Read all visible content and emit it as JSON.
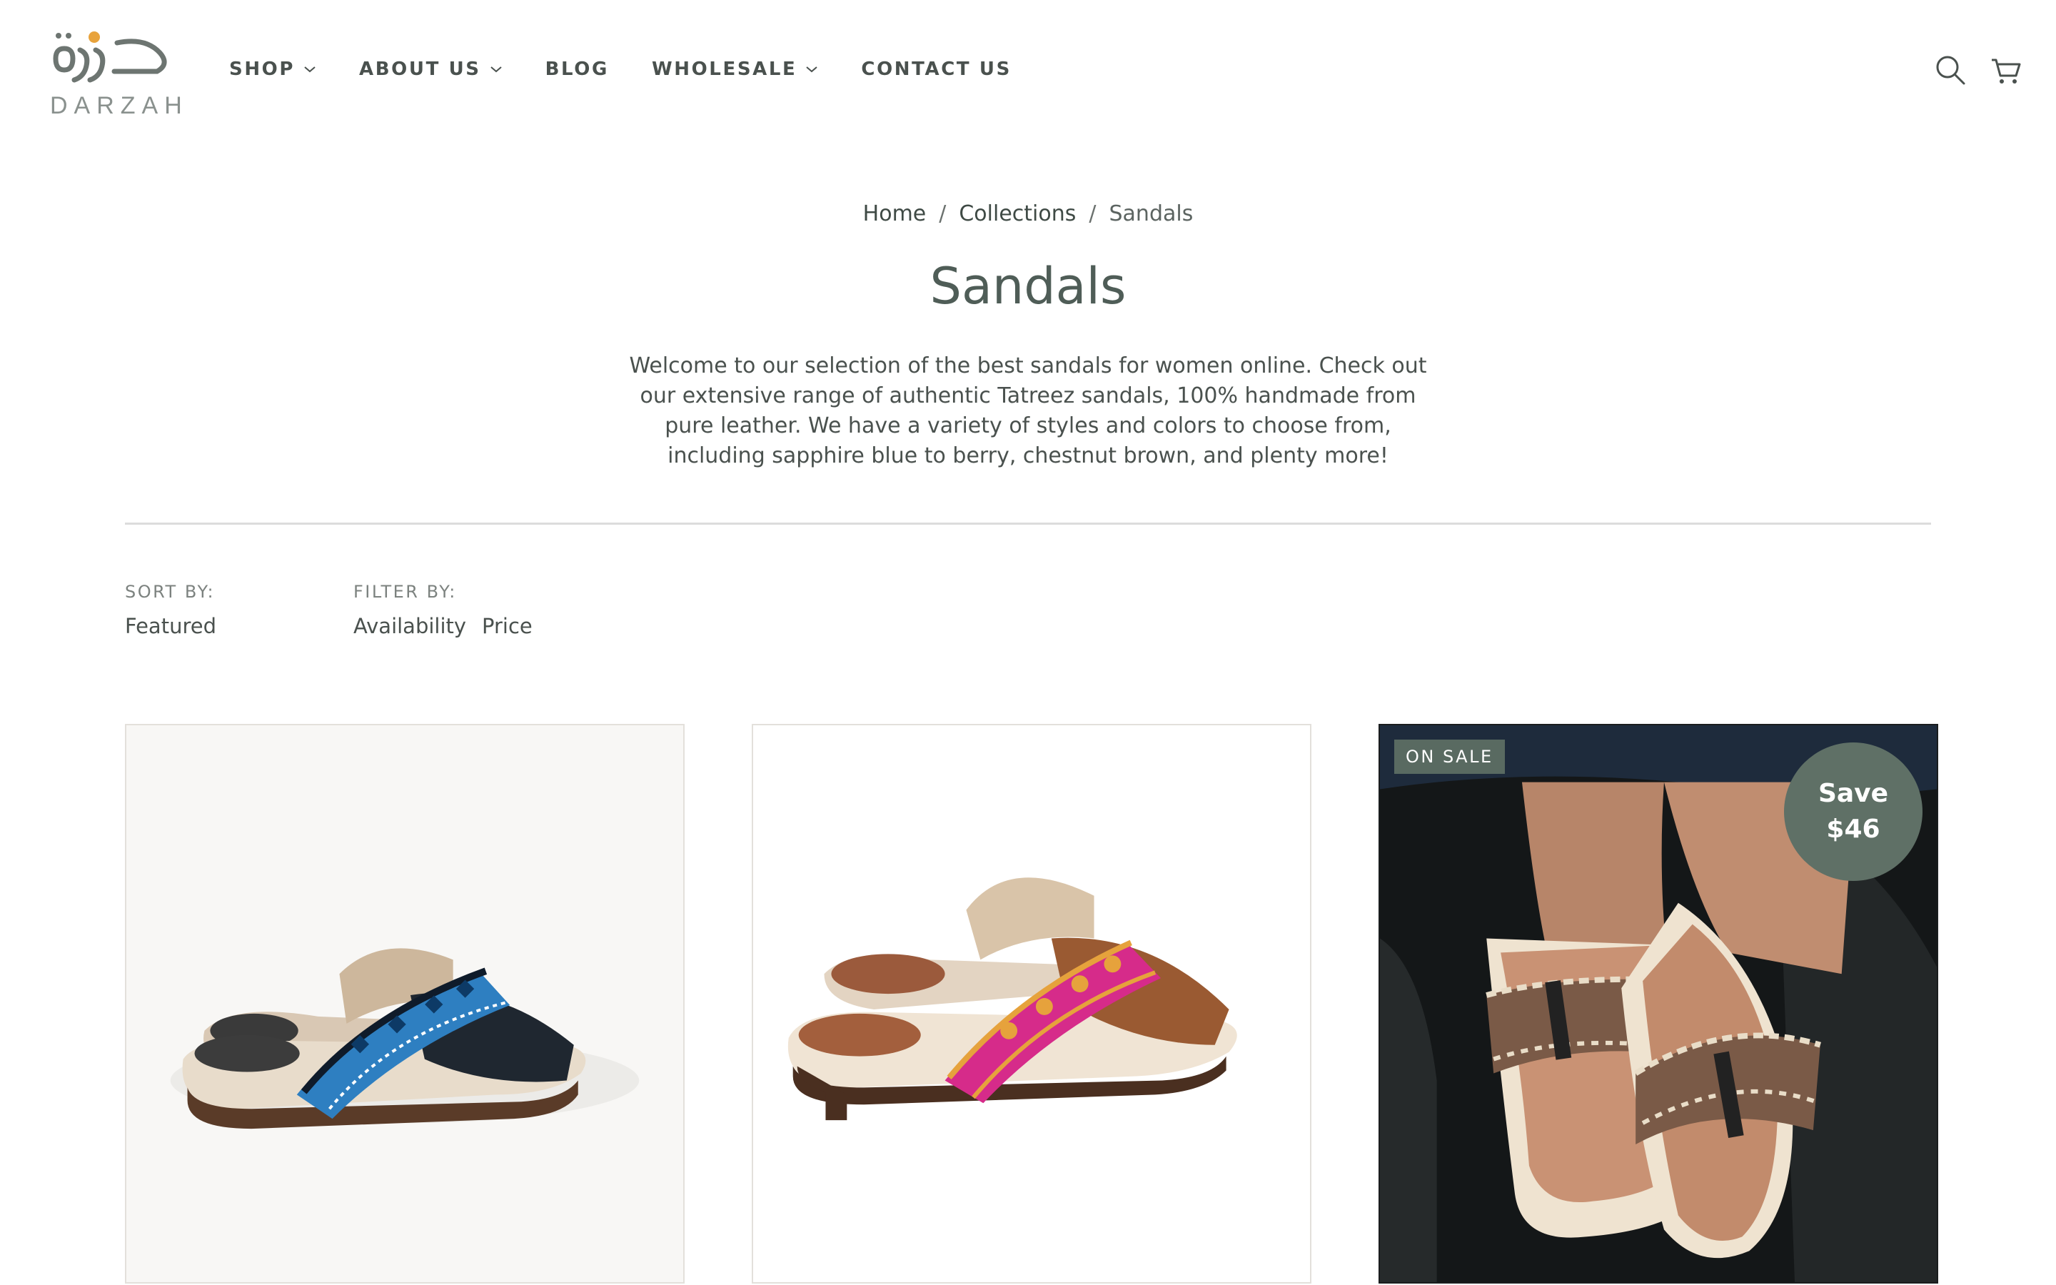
{
  "brand": {
    "logo_arabic": "درزة",
    "logo_word": "DARZAH"
  },
  "nav": {
    "items": [
      {
        "label": "SHOP",
        "has_dropdown": true
      },
      {
        "label": "ABOUT US",
        "has_dropdown": true
      },
      {
        "label": "BLOG",
        "has_dropdown": false
      },
      {
        "label": "WHOLESALE",
        "has_dropdown": true
      },
      {
        "label": "CONTACT US",
        "has_dropdown": false
      }
    ]
  },
  "header_icons": {
    "search": "search-icon",
    "cart": "cart-icon"
  },
  "breadcrumb": {
    "home": "Home",
    "sep": "/",
    "collections": "Collections",
    "current": "Sandals"
  },
  "page": {
    "title": "Sandals",
    "description": "Welcome to our selection of the best sandals for women online. Check out our extensive range of authentic Tatreez sandals, 100% handmade from pure leather. We have a variety of styles and colors to choose from, including sapphire blue to berry, chestnut brown, and plenty more!"
  },
  "controls": {
    "sort_label": "SORT BY:",
    "sort_value": "Featured",
    "filter_label": "FILTER BY:",
    "filters": [
      "Availability",
      "Price"
    ]
  },
  "products": [
    {
      "image": "blue-tatreez-sandal",
      "badges": []
    },
    {
      "image": "pink-tatreez-sandal",
      "badges": []
    },
    {
      "image": "brown-tatreez-sandal-worn",
      "sale_badge": "ON SALE",
      "save_line1": "Save",
      "save_line2": "$46"
    }
  ],
  "colors": {
    "text": "#4a514e",
    "title": "#4f5d57",
    "badge": "#596a61",
    "accent_orange": "#e8a33c"
  }
}
